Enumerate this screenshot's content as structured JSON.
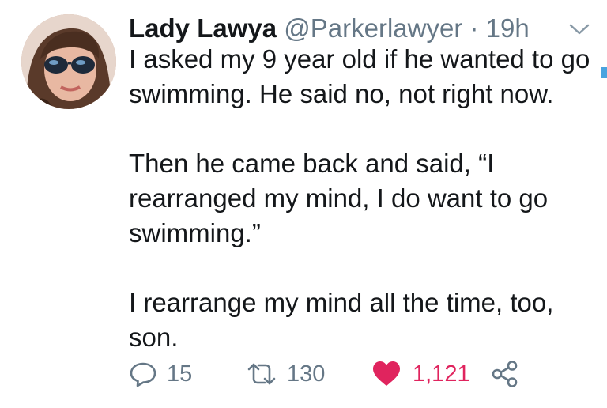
{
  "tweet": {
    "display_name": "Lady Lawya",
    "handle": "@Parkerlawyer",
    "separator": "·",
    "timestamp": "19h",
    "paragraphs": [
      "I asked my 9 year old if he wanted to go swimming. He said no, not right now.",
      "Then he came back and said, “I rearranged my mind, I do want to go swimming.”",
      "I rearrange my mind all the time, too, son."
    ],
    "counts": {
      "replies": "15",
      "retweets": "130",
      "likes": "1,121"
    }
  },
  "icons": {
    "caret": "chevron-down-icon",
    "reply": "reply-icon",
    "retweet": "retweet-icon",
    "like": "heart-icon",
    "share": "share-icon"
  },
  "colors": {
    "text": "#14171a",
    "secondary": "#657786",
    "like": "#e0245e"
  }
}
